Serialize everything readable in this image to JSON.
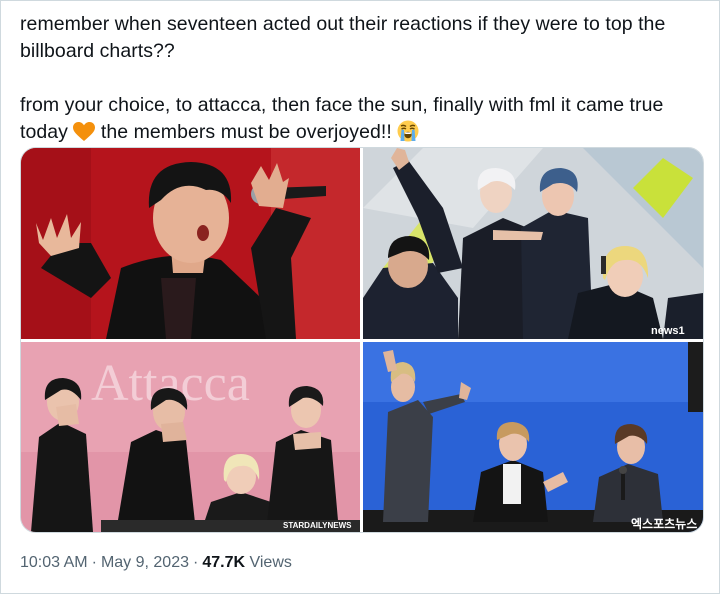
{
  "tweet": {
    "line1": "remember when seventeen acted out their reactions if they were to top the billboard charts??",
    "line2_start": "from your choice, to attacca, then face the sun, finally with fml it came true today",
    "line2_mid": "the members must be overjoyed!!",
    "emoji1": "orange-heart-icon",
    "emoji2": "loudly-crying-face-icon"
  },
  "media": {
    "photos": [
      {
        "name": "red-stage-photo",
        "colors": {
          "bg": "#b5141c"
        }
      },
      {
        "name": "press-conference-photo",
        "watermark": "news1",
        "colors": {
          "bg": "#cfd5da"
        }
      },
      {
        "name": "attacca-backdrop-photo",
        "backdrop_text": "Attacca",
        "watermark": "STARDAILYNEWS",
        "colors": {
          "bg": "#e8a2b2"
        }
      },
      {
        "name": "blue-stage-photo",
        "watermark": "엑스포츠뉴스",
        "colors": {
          "bg": "#2a62d6"
        }
      }
    ]
  },
  "meta": {
    "time": "10:03 AM",
    "separator": "·",
    "date": "May 9, 2023",
    "views_count": "47.7K",
    "views_label": "Views"
  },
  "colors": {
    "text": "#0f1419",
    "secondary": "#536471",
    "border": "#cfd9de"
  }
}
